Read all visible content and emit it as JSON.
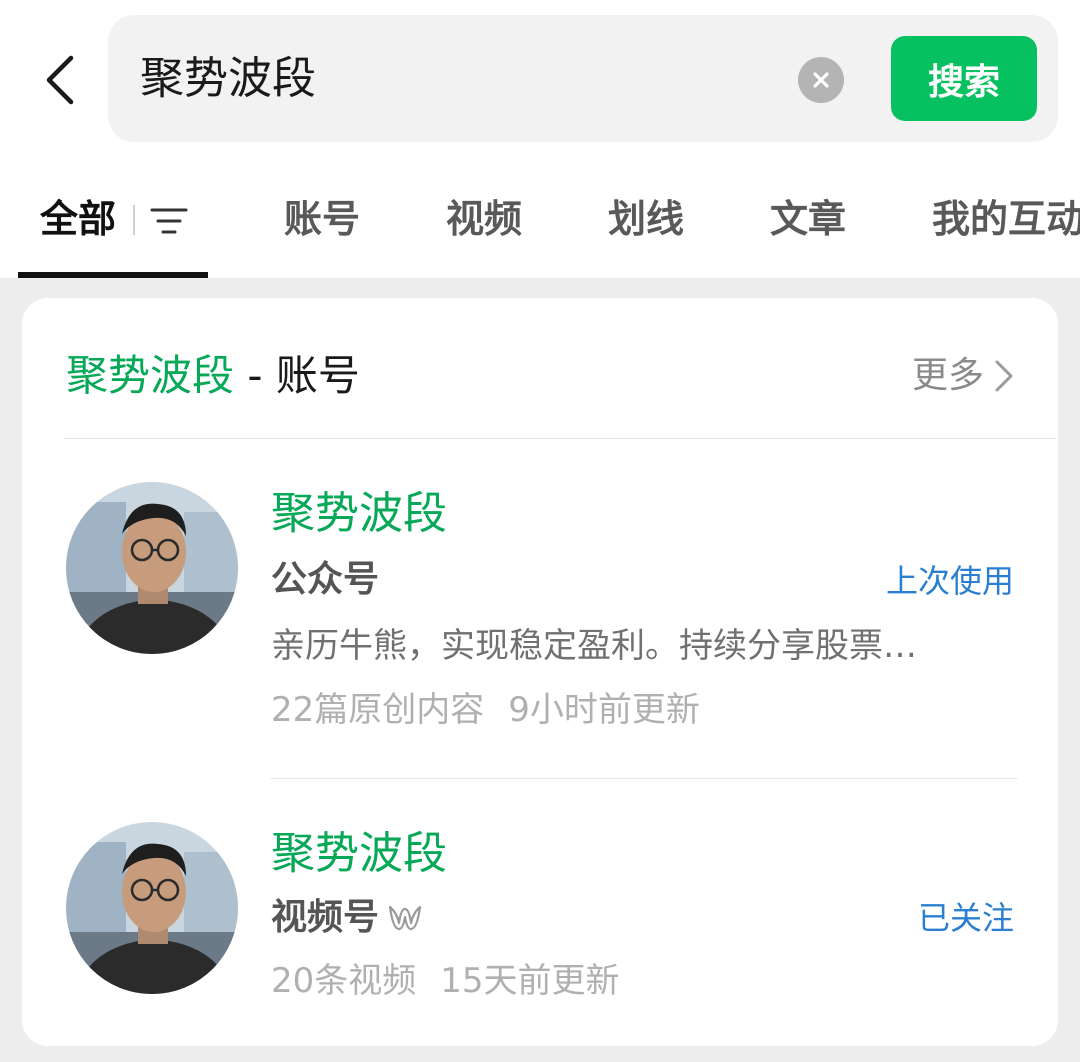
{
  "search": {
    "query": "聚势波段",
    "button_label": "搜索"
  },
  "tabs": [
    {
      "label": "全部",
      "active": true
    },
    {
      "label": "账号"
    },
    {
      "label": "视频"
    },
    {
      "label": "划线"
    },
    {
      "label": "文章"
    },
    {
      "label": "我的互动"
    }
  ],
  "section": {
    "keyword": "聚势波段",
    "suffix": " - 账号",
    "more_label": "更多"
  },
  "accounts": [
    {
      "name": "聚势波段",
      "type": "公众号",
      "status": "上次使用",
      "description": "亲历牛熊，实现稳定盈利。持续分享股票…",
      "meta1": "22篇原创内容",
      "meta2": "9小时前更新",
      "icon": "account-avatar"
    },
    {
      "name": "聚势波段",
      "type": "视频号",
      "status": "已关注",
      "meta1": "20条视频",
      "meta2": "15天前更新",
      "type_icon": "channels-icon",
      "icon": "account-avatar"
    }
  ],
  "colors": {
    "brand_green": "#07c160",
    "keyword_green": "#07a857",
    "status_blue": "#2a7fd0"
  }
}
